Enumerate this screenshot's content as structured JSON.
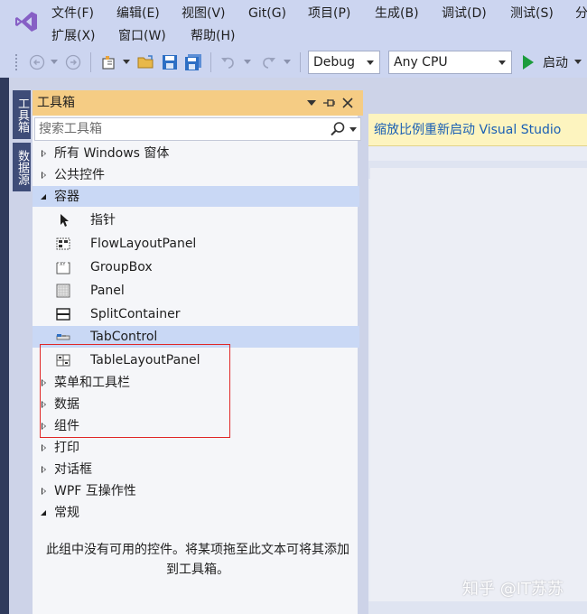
{
  "menu": {
    "row1": [
      "文件(F)",
      "编辑(E)",
      "视图(V)",
      "Git(G)",
      "项目(P)",
      "生成(B)",
      "调试(D)",
      "测试(S)",
      "分"
    ],
    "row2": [
      "扩展(X)",
      "窗口(W)",
      "帮助(H)"
    ]
  },
  "toolbar": {
    "config_value": "Debug",
    "platform_value": "Any CPU",
    "start_label": "启动"
  },
  "side_tabs": [
    "工具箱",
    "数据源"
  ],
  "toolbox": {
    "title": "工具箱",
    "search_placeholder": "搜索工具箱",
    "tree": [
      {
        "type": "category",
        "label": "所有 Windows 窗体",
        "expanded": false
      },
      {
        "type": "category",
        "label": "公共控件",
        "expanded": false
      },
      {
        "type": "category",
        "label": "容器",
        "expanded": true,
        "selected": true
      },
      {
        "type": "item",
        "label": "指针",
        "icon": "pointer-icon"
      },
      {
        "type": "item",
        "label": "FlowLayoutPanel",
        "icon": "flowlayoutpanel-icon"
      },
      {
        "type": "item",
        "label": "GroupBox",
        "icon": "groupbox-icon"
      },
      {
        "type": "item",
        "label": "Panel",
        "icon": "panel-icon"
      },
      {
        "type": "item",
        "label": "SplitContainer",
        "icon": "splitcontainer-icon"
      },
      {
        "type": "item",
        "label": "TabControl",
        "icon": "tabcontrol-icon",
        "selected": true
      },
      {
        "type": "item",
        "label": "TableLayoutPanel",
        "icon": "tablelayoutpanel-icon"
      },
      {
        "type": "category",
        "label": "菜单和工具栏",
        "expanded": false
      },
      {
        "type": "category",
        "label": "数据",
        "expanded": false
      },
      {
        "type": "category",
        "label": "组件",
        "expanded": false
      },
      {
        "type": "category",
        "label": "打印",
        "expanded": false
      },
      {
        "type": "category",
        "label": "对话框",
        "expanded": false
      },
      {
        "type": "category",
        "label": "WPF 互操作性",
        "expanded": false
      },
      {
        "type": "category",
        "label": "常规",
        "expanded": true
      }
    ],
    "empty_message": "此组中没有可用的控件。将某项拖至此文本可将其添加到工具箱。"
  },
  "infobar": {
    "text": "缩放比例重新启动 Visual Studio"
  },
  "watermark": "知乎 @IT苏苏",
  "colors": {
    "accent_header": "#f5cc84",
    "selected_row": "#c9d8f5",
    "highlight_border": "#e02828",
    "start_green": "#1c9c3c",
    "infobar_bg": "#fdf4bf",
    "logo_purple": "#865fc5"
  }
}
